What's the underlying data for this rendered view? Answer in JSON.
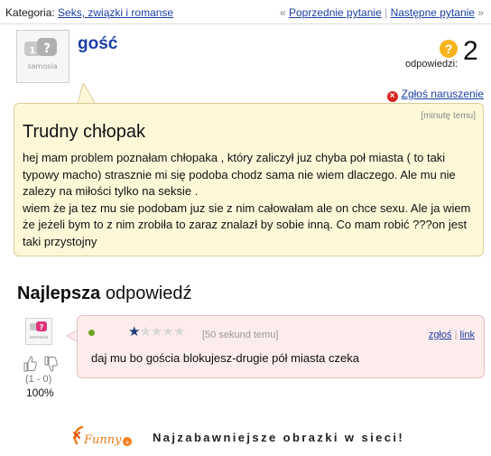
{
  "breadcrumb": {
    "label": "Kategoria:",
    "category": "Seks, związki i romanse"
  },
  "nav": {
    "prev_marker": "«",
    "prev_label": "Poprzednie pytanie",
    "separator": "|",
    "next_label": "Następne pytanie",
    "next_marker": "»"
  },
  "asker": {
    "name": "gość",
    "avatar_text": "samosia"
  },
  "answers": {
    "label": "odpowiedzi:",
    "count": "2",
    "icon": "question-mark-icon"
  },
  "report": {
    "label": "Zgłoś naruszenie"
  },
  "question": {
    "time": "[minutę temu]",
    "title": "Trudny chłopak",
    "paragraphs": [
      "hej mam problem poznałam chłopaka , który zaliczył juz chyba poł miasta ( to taki typowy macho) strasznie mi się podoba chodz sama nie wiem dlaczego. Ale mu nie zalezy na miłości tylko na seksie .",
      "wiem że ja tez mu sie podobam juz sie z nim całowałam ale on chce sexu. Ale ja wiem że jeżeli bym to z nim zrobiła to zaraz znalazł by sobie inną. Co mam robić ???on jest taki przystojny"
    ]
  },
  "best_answer": {
    "heading_bold": "Najlepsza",
    "heading_rest": "odpowiedź",
    "avatar_text": "samosia",
    "votes": "(1 - 0)",
    "percent": "100%",
    "rating": 0.5,
    "rating_max": 5,
    "time": "[50 sekund temu]",
    "report_link": "zgłoś",
    "link_label": "link",
    "text": "daj mu bo gościa blokujesz-drugie pół miasta czeka"
  },
  "footer": {
    "brand": "Funny",
    "slogan": "Najzabawniejsze obrazki w sieci!"
  },
  "colors": {
    "link": "#1c3fa5",
    "question_bg": "#fff8d8",
    "answer_bg": "#fdecec",
    "report_icon": "#d8261f",
    "answers_icon": "#f6b51e",
    "brand_orange": "#f07d1a"
  }
}
